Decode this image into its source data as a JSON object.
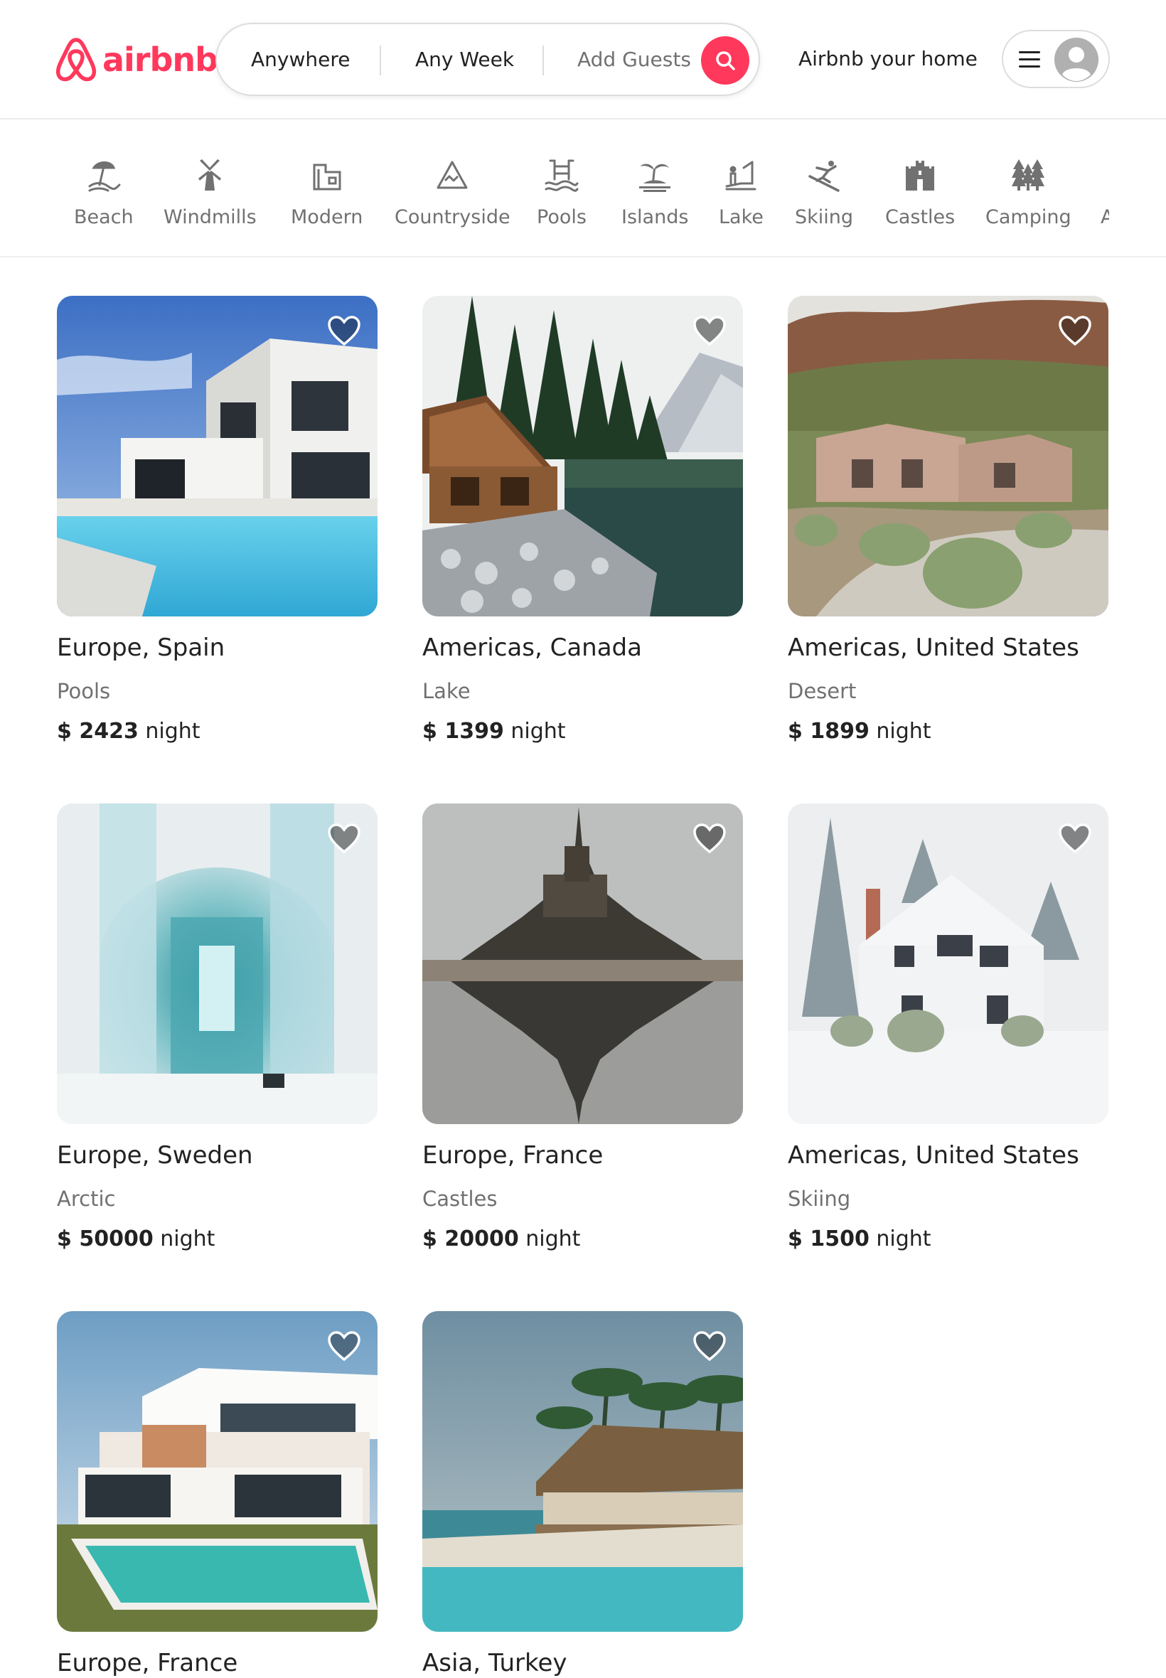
{
  "header": {
    "logo_text": "airbnb",
    "search": {
      "where": "Anywhere",
      "when": "Any Week",
      "guests": "Add Guests"
    },
    "host_link": "Airbnb your home"
  },
  "categories": [
    {
      "label": "Beach",
      "icon": "beach-icon"
    },
    {
      "label": "Windmills",
      "icon": "windmill-icon"
    },
    {
      "label": "Modern",
      "icon": "modern-house-icon"
    },
    {
      "label": "Countryside",
      "icon": "mountain-icon"
    },
    {
      "label": "Pools",
      "icon": "pool-icon"
    },
    {
      "label": "Islands",
      "icon": "island-icon"
    },
    {
      "label": "Lake",
      "icon": "lake-icon"
    },
    {
      "label": "Skiing",
      "icon": "skiing-icon"
    },
    {
      "label": "Castles",
      "icon": "castle-icon"
    },
    {
      "label": "Camping",
      "icon": "camping-icon"
    },
    {
      "label": "A",
      "icon": "more-icon"
    }
  ],
  "listings": [
    {
      "title": "Europe, Spain",
      "category": "Pools",
      "price": "$ 2423",
      "unit": "night"
    },
    {
      "title": "Americas, Canada",
      "category": "Lake",
      "price": "$ 1399",
      "unit": "night"
    },
    {
      "title": "Americas, United States",
      "category": "Desert",
      "price": "$ 1899",
      "unit": "night"
    },
    {
      "title": "Europe, Sweden",
      "category": "Arctic",
      "price": "$ 50000",
      "unit": "night"
    },
    {
      "title": "Europe, France",
      "category": "Castles",
      "price": "$ 20000",
      "unit": "night"
    },
    {
      "title": "Americas, United States",
      "category": "Skiing",
      "price": "$ 1500",
      "unit": "night"
    },
    {
      "title": "Europe, France",
      "category": "",
      "price": "",
      "unit": ""
    },
    {
      "title": "Asia, Turkey",
      "category": "",
      "price": "",
      "unit": ""
    }
  ],
  "colors": {
    "brand": "#ff385c",
    "text": "#222222",
    "muted": "#717171",
    "border": "#dddddd"
  }
}
